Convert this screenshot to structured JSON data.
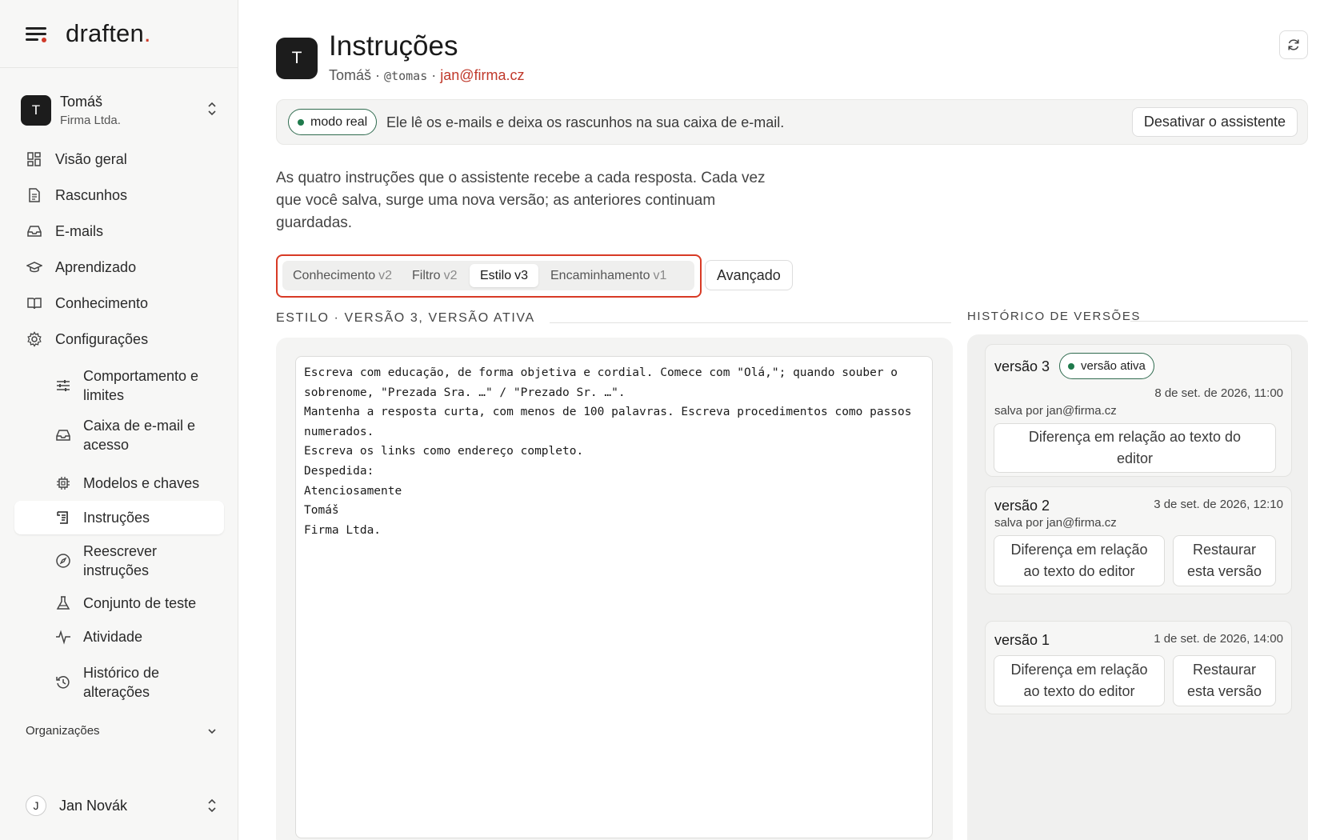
{
  "brand": {
    "name": "draften",
    "dot": "."
  },
  "workspace": {
    "initial": "T",
    "name": "Tomáš",
    "company": "Firma Ltda."
  },
  "nav": [
    {
      "label": "Visão geral",
      "icon": "dashboard-icon"
    },
    {
      "label": "Rascunhos",
      "icon": "document-icon"
    },
    {
      "label": "E-mails",
      "icon": "inbox-icon"
    },
    {
      "label": "Aprendizado",
      "icon": "graduation-cap-icon"
    },
    {
      "label": "Conhecimento",
      "icon": "book-icon"
    },
    {
      "label": "Configurações",
      "icon": "gear-icon"
    },
    {
      "label": "Comportamento e limites",
      "icon": "sliders-icon"
    },
    {
      "label": "Caixa de e-mail e acesso",
      "icon": "inbox-icon"
    },
    {
      "label": "Modelos e chaves",
      "icon": "chip-icon"
    },
    {
      "label": "Instruções",
      "icon": "instructions-icon"
    },
    {
      "label": "Reescrever instruções",
      "icon": "compass-icon"
    },
    {
      "label": "Conjunto de teste",
      "icon": "flask-icon"
    },
    {
      "label": "Atividade",
      "icon": "activity-icon"
    },
    {
      "label": "Histórico de alterações",
      "icon": "history-icon"
    }
  ],
  "organizations": {
    "label": "Organizações"
  },
  "user": {
    "initial": "J",
    "name": "Jan Novák"
  },
  "header": {
    "initial": "T",
    "title": "Instruções",
    "name": "Tomáš",
    "sep1": "·",
    "handle": "@tomas",
    "sep2": "·",
    "email": "jan@firma.cz"
  },
  "banner": {
    "mode": "modo real",
    "text": "Ele lê os e-mails e deixa os rascunhos na sua caixa de e-mail.",
    "deactivate": "Desativar o assistente"
  },
  "description": "As quatro instruções que o assistente recebe a cada resposta. Cada vez que você salva, surge uma nova versão; as anteriores continuam guardadas.",
  "tabs": [
    {
      "label": "Conhecimento",
      "version": "v2"
    },
    {
      "label": "Filtro",
      "version": "v2"
    },
    {
      "label": "Estilo",
      "version": "v3",
      "active": true
    },
    {
      "label": "Encaminhamento",
      "version": "v1"
    }
  ],
  "advanced": "Avançado",
  "section": {
    "title": "ESTILO · VERSÃO 3, VERSÃO ATIVA"
  },
  "editor": {
    "text": "Escreva com educação, de forma objetiva e cordial. Comece com \"Olá,\"; quando souber o sobrenome, \"Prezada Sra. …\" / \"Prezado Sr. …\".\nMantenha a resposta curta, com menos de 100 palavras. Escreva procedimentos como passos numerados.\nEscreva os links como endereço completo.\nDespedida:\nAtenciosamente\nTomáš\nFirma Ltda."
  },
  "history": {
    "title": "HISTÓRICO DE VERSÕES",
    "versions": [
      {
        "name": "versão 3",
        "badge": "versão ativa",
        "date": "8 de set. de 2026, 11:00",
        "by": "salva por jan@firma.cz",
        "diff": "Diferença em relação ao texto do editor"
      },
      {
        "name": "versão 2",
        "date": "3 de set. de 2026, 12:10",
        "by": "salva por jan@firma.cz",
        "diff": "Diferença em relação ao texto do editor",
        "restore": "Restaurar esta versão"
      },
      {
        "name": "versão 1",
        "date": "1 de set. de 2026, 14:00",
        "diff": "Diferença em relação ao texto do editor",
        "restore": "Restaurar esta versão"
      }
    ]
  },
  "colors": {
    "accent": "#d03b2a",
    "active_green": "#1f7a4c",
    "highlight_border": "#d83a25"
  }
}
